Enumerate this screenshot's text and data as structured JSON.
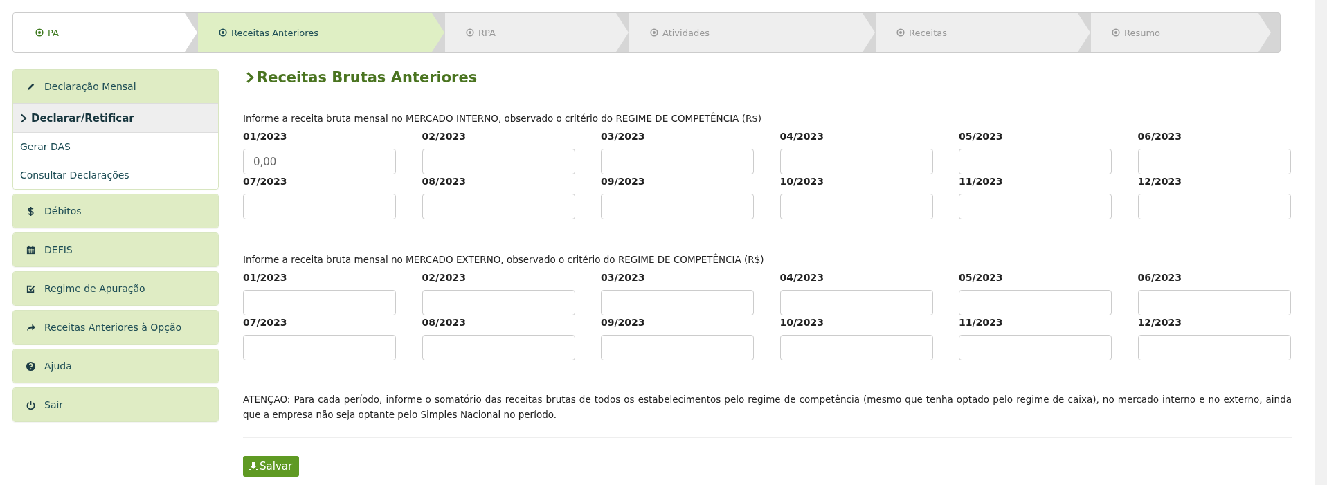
{
  "steps": [
    {
      "label": "PA",
      "selected": false,
      "completed": true
    },
    {
      "label": "Receitas Anteriores",
      "selected": true,
      "completed": false
    },
    {
      "label": "RPA",
      "selected": false,
      "completed": false
    },
    {
      "label": "Atividades",
      "selected": false,
      "completed": false
    },
    {
      "label": "Receitas",
      "selected": false,
      "completed": false
    },
    {
      "label": "Resumo",
      "selected": false,
      "completed": false
    }
  ],
  "sidebar": {
    "groups": [
      {
        "label": "Declaração Mensal",
        "children": [
          {
            "label": "Declarar/Retificar",
            "selected": true
          },
          {
            "label": "Gerar DAS",
            "selected": false
          },
          {
            "label": "Consultar Declarações",
            "selected": false
          }
        ]
      },
      {
        "label": "Débitos"
      },
      {
        "label": "DEFIS"
      },
      {
        "label": "Regime de Apuração"
      },
      {
        "label": "Receitas Anteriores à Opção"
      },
      {
        "label": "Ajuda"
      },
      {
        "label": "Sair"
      }
    ]
  },
  "heading": "Receitas Brutas Anteriores",
  "sections": [
    {
      "instruction": "Informe a receita bruta mensal no MERCADO INTERNO, observado o critério do REGIME DE COMPETÊNCIA (R$)",
      "fields": [
        {
          "label": "01/2023",
          "placeholder": "0,00"
        },
        {
          "label": "02/2023"
        },
        {
          "label": "03/2023"
        },
        {
          "label": "04/2023"
        },
        {
          "label": "05/2023"
        },
        {
          "label": "06/2023"
        },
        {
          "label": "07/2023"
        },
        {
          "label": "08/2023"
        },
        {
          "label": "09/2023"
        },
        {
          "label": "10/2023"
        },
        {
          "label": "11/2023"
        },
        {
          "label": "12/2023"
        }
      ]
    },
    {
      "instruction": "Informe a receita bruta mensal no MERCADO EXTERNO, observado o critério do REGIME DE COMPETÊNCIA (R$)",
      "fields": [
        {
          "label": "01/2023"
        },
        {
          "label": "02/2023"
        },
        {
          "label": "03/2023"
        },
        {
          "label": "04/2023"
        },
        {
          "label": "05/2023"
        },
        {
          "label": "06/2023"
        },
        {
          "label": "07/2023"
        },
        {
          "label": "08/2023"
        },
        {
          "label": "09/2023"
        },
        {
          "label": "10/2023"
        },
        {
          "label": "11/2023"
        },
        {
          "label": "12/2023"
        }
      ]
    }
  ],
  "notice": "ATENÇÃO: Para cada período, informe o somatório das receitas brutas de todos os estabelecimentos pelo regime de competência (mesmo que tenha optado pelo regime de caixa), no mercado interno e no externo, ainda que a empresa não seja optante pelo Simples Nacional no período.",
  "save_button": "Salvar"
}
